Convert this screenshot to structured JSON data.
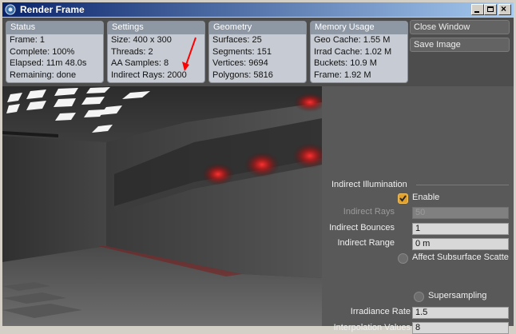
{
  "window": {
    "title": "Render Frame"
  },
  "panels": {
    "status": {
      "header": "Status",
      "lines": [
        "Frame: 1",
        "Complete: 100%",
        "Elapsed: 11m 48.0s",
        "Remaining: done"
      ]
    },
    "settings": {
      "header": "Settings",
      "lines": [
        "Size: 400 x 300",
        "Threads: 2",
        "AA Samples: 8",
        "Indirect Rays: 2000"
      ]
    },
    "geometry": {
      "header": "Geometry",
      "lines": [
        "Surfaces: 25",
        "Segments: 151",
        "Vertices: 9694",
        "Polygons: 5816"
      ]
    },
    "memory": {
      "header": "Memory Usage",
      "lines": [
        "Geo Cache: 1.55 M",
        "Irrad Cache: 1.02 M",
        "Buckets: 10.9 M",
        "Frame: 1.92 M"
      ]
    }
  },
  "buttons": {
    "close": "Close Window",
    "save": "Save Image"
  },
  "indirect": {
    "section_title": "Indirect Illumination",
    "enable_label": "Enable",
    "rays_label": "Indirect Rays",
    "rays_value": "50",
    "bounces_label": "Indirect Bounces",
    "bounces_value": "1",
    "range_label": "Indirect Range",
    "range_value": "0 m",
    "subsurface_label": "Affect Subsurface Scatte",
    "supersampling_label": "Supersampling",
    "irradiance_label": "Irradiance Rate",
    "irradiance_value": "1.5",
    "interp_label": "Interpolation Values",
    "interp_value": "8"
  },
  "colors": {
    "title_start": "#0a246a",
    "title_end": "#a6caf0",
    "check_on": "#e3a02a",
    "annotation_arrow": "#ff0000"
  }
}
